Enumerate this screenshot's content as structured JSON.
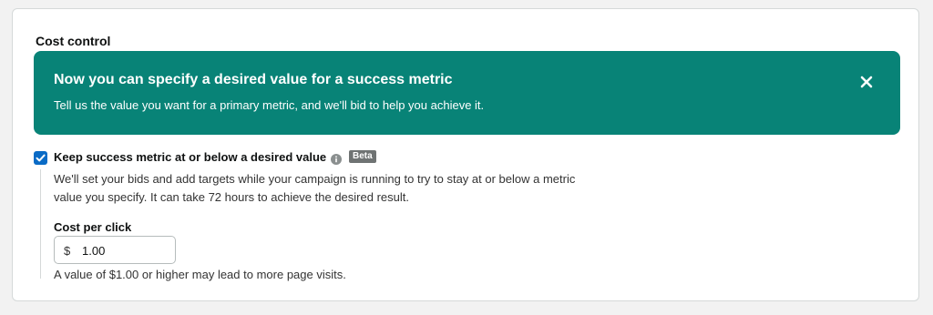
{
  "section": {
    "title": "Cost control"
  },
  "banner": {
    "title": "Now you can specify a desired value for a success metric",
    "description": "Tell us the value you want for a primary metric, and we'll bid to help you achieve it.",
    "background_color": "#088377",
    "close_icon": "close-icon"
  },
  "success_metric": {
    "checkbox_checked": true,
    "label": "Keep success metric at or below a desired value",
    "info_icon": "info-icon",
    "badge": "Beta",
    "description_line1": "We'll set your bids and add targets while your campaign is running to try to stay at or below a metric",
    "description_line2": "value you specify. It can take 72 hours to achieve the desired result."
  },
  "cost_per_click": {
    "label": "Cost per click",
    "currency_symbol": "$",
    "value": "1.00",
    "hint": "A value of $1.00 or higher may lead to more page visits."
  },
  "colors": {
    "accent": "#0a6bc6",
    "banner": "#088377"
  }
}
